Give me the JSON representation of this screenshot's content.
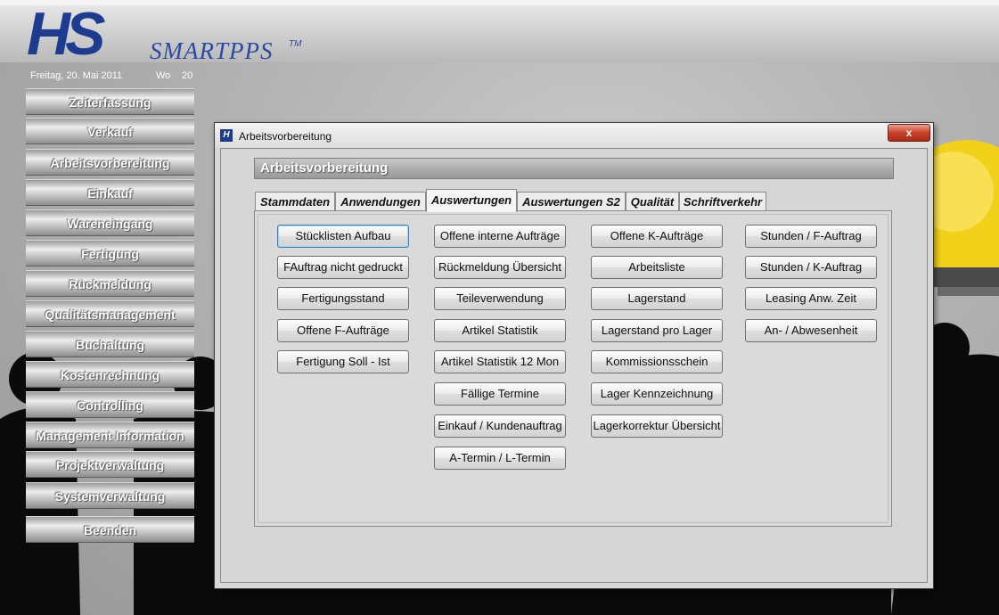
{
  "brand": {
    "mark": "HS",
    "name": "SMARTPPS",
    "tm": "TM"
  },
  "date_row": {
    "date": "Freitag, 20. Mai 2011",
    "week_label": "Wo",
    "week_number": "20"
  },
  "sidebar": {
    "items": [
      {
        "label": "Zeiterfassung"
      },
      {
        "label": "Verkauf"
      },
      {
        "label": "Arbeitsvorbereitung"
      },
      {
        "label": "Einkauf"
      },
      {
        "label": "Wareneingang"
      },
      {
        "label": "Fertigung"
      },
      {
        "label": "Rückmeldung"
      },
      {
        "label": "Qualitätsmanagement"
      },
      {
        "label": "Buchaltung"
      },
      {
        "label": "Kostenrechnung"
      },
      {
        "label": "Controlling"
      },
      {
        "label": "Management Information"
      },
      {
        "label": "Projektverwaltung"
      },
      {
        "label": "Systemverwaltung"
      },
      {
        "label": "Beenden"
      }
    ]
  },
  "dialog": {
    "icon": "app-logo-icon",
    "title": "Arbeitsvorbereitung",
    "close_label": "x",
    "section_title": "Arbeitsvorbereitung",
    "tabs": [
      {
        "label": "Stammdaten"
      },
      {
        "label": "Anwendungen"
      },
      {
        "label": "Auswertungen",
        "active": true
      },
      {
        "label": "Auswertungen S2"
      },
      {
        "label": "Qualität"
      },
      {
        "label": "Schriftverkehr"
      }
    ],
    "columns": [
      [
        "Stücklisten Aufbau",
        "FAuftrag nicht gedruckt",
        "Fertigungsstand",
        "Offene F-Aufträge",
        "Fertigung Soll - Ist"
      ],
      [
        "Offene interne Aufträge",
        "Rückmeldung Übersicht",
        "Teileverwendung",
        "Artikel Statistik",
        "Artikel Statistik 12 Mon",
        "Fällige Termine",
        "Einkauf / Kundenauftrag",
        "A-Termin / L-Termin"
      ],
      [
        "Offene K-Aufträge",
        "Arbeitsliste",
        "Lagerstand",
        "Lagerstand pro Lager",
        "Kommissionsschein",
        "Lager Kennzeichnung",
        "Lagerkorrektur Übersicht"
      ],
      [
        "Stunden / F-Auftrag",
        "Stunden / K-Auftrag",
        "Leasing Anw. Zeit",
        "An- / Abwesenheit"
      ]
    ]
  },
  "colors": {
    "brand_blue": "#1d3b8f",
    "close_red": "#c8412a",
    "bulb_yellow": "#f2d11a"
  }
}
